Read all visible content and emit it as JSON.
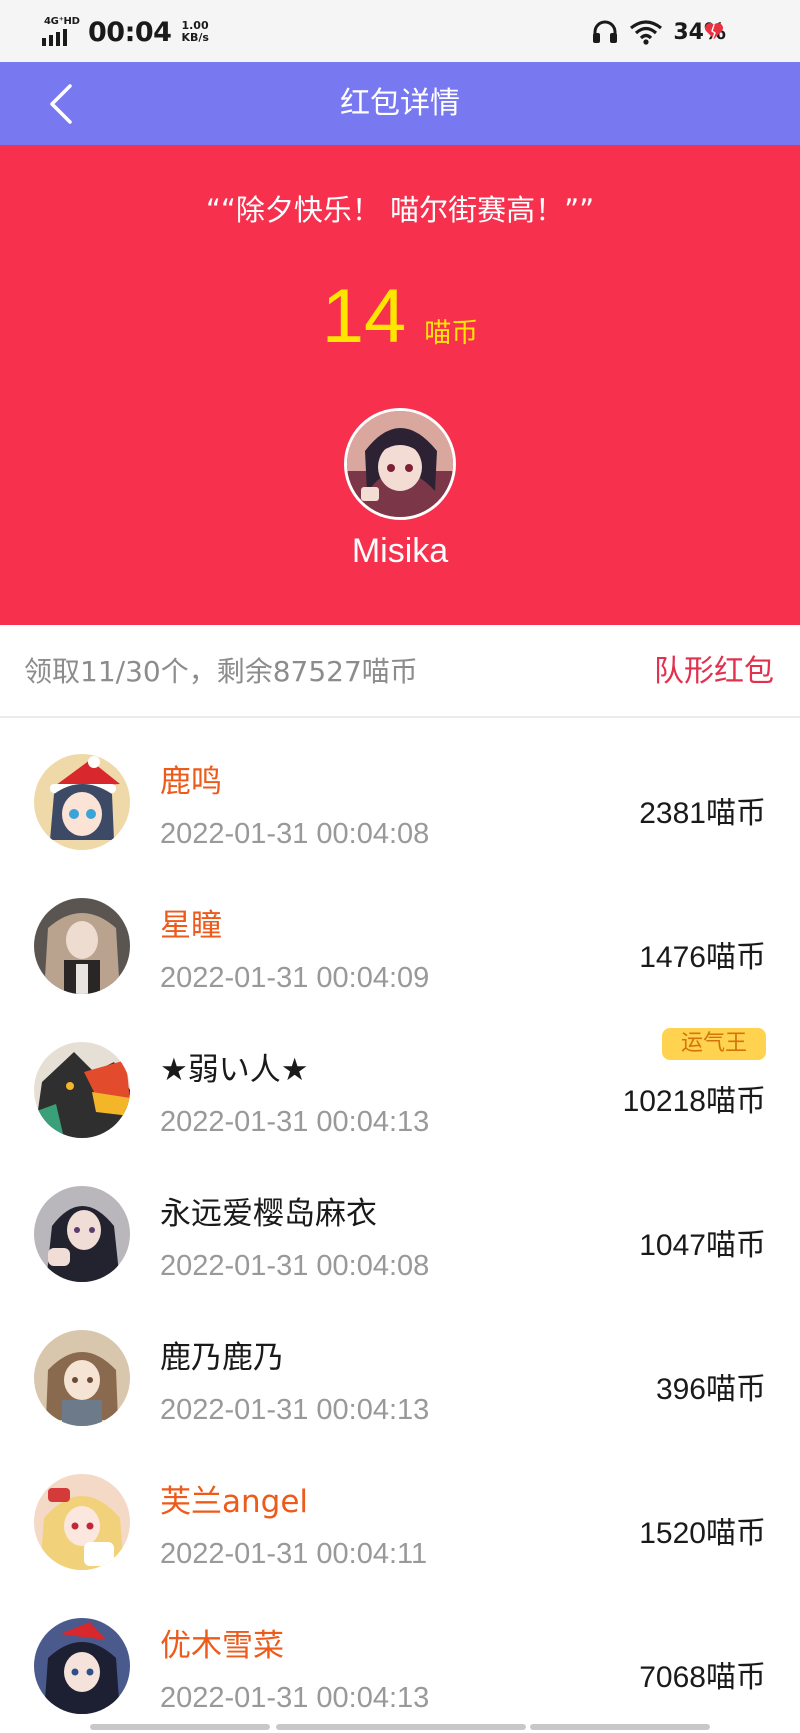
{
  "status_bar": {
    "network": "4G⁺HD",
    "time": "00:04",
    "speed_value": "1.00",
    "speed_unit": "KB/s",
    "battery": "34%",
    "icons": [
      "signal-icon",
      "headphones-icon",
      "wifi-icon",
      "heart-icon"
    ]
  },
  "navbar": {
    "title": "红包详情",
    "back_icon": "chevron-left-icon"
  },
  "hero": {
    "greeting": "““除夕快乐！ 喵尔街赛高！””",
    "amount": "14",
    "amount_unit": "喵币",
    "sender_name": "Misika"
  },
  "summary": {
    "text": "领取11/30个，剩余87527喵币",
    "formation_label": "队形红包"
  },
  "recipients": [
    {
      "name": "鹿鸣",
      "time": "2022-01-31 00:04:08",
      "coins": "2381喵币",
      "name_color": "orange"
    },
    {
      "name": "星瞳",
      "time": "2022-01-31 00:04:09",
      "coins": "1476喵币",
      "name_color": "orange"
    },
    {
      "name": "★弱い人★",
      "time": "2022-01-31 00:04:13",
      "coins": "10218喵币",
      "badge": "运气王",
      "name_color": "black"
    },
    {
      "name": "永远爱樱岛麻衣",
      "time": "2022-01-31 00:04:08",
      "coins": "1047喵币",
      "name_color": "black"
    },
    {
      "name": "鹿乃鹿乃",
      "time": "2022-01-31 00:04:13",
      "coins": "396喵币",
      "name_color": "black"
    },
    {
      "name": "芙兰angel",
      "time": "2022-01-31 00:04:11",
      "coins": "1520喵币",
      "name_color": "orange"
    },
    {
      "name": "优木雪菜",
      "time": "2022-01-31 00:04:13",
      "coins": "7068喵币",
      "name_color": "orange"
    }
  ],
  "colors": {
    "navbar": "#7879f1",
    "hero": "#f7304e",
    "amount": "#ffe600",
    "formation": "#e2314f",
    "orange_name": "#ee5a1a",
    "badge_bg": "#ffd34f"
  }
}
